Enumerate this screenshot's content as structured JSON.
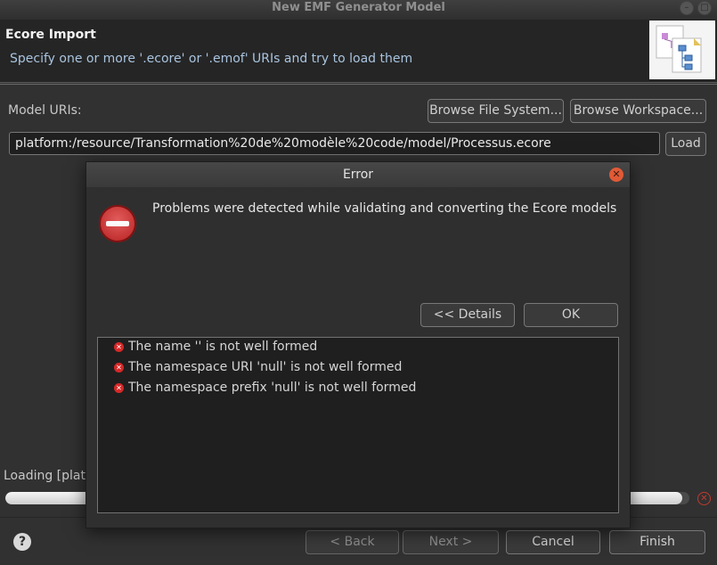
{
  "window": {
    "title": "New EMF Generator Model"
  },
  "header": {
    "title": "Ecore Import",
    "description": "Specify one or more '.ecore' or '.emof' URIs and try to load them",
    "image_icon": "ecore-import-wizard-icon"
  },
  "form": {
    "model_uris_label": "Model URIs:",
    "browse_file_system": "Browse File System...",
    "browse_workspace": "Browse Workspace...",
    "uri_value": "platform:/resource/Transformation%20de%20modèle%20code/model/Processus.ecore",
    "load": "Load"
  },
  "status": {
    "loading_text": "Loading [platf",
    "progress_fraction": 0.99
  },
  "footer": {
    "help_icon": "help-icon",
    "back": "< Back",
    "next": "Next >",
    "cancel": "Cancel",
    "finish": "Finish"
  },
  "dialog": {
    "title": "Error",
    "message": "Problems were detected while validating and converting the Ecore models",
    "details_button": "<< Details",
    "ok_button": "OK",
    "details": [
      "The name '' is not well formed",
      "The namespace URI 'null' is not well formed",
      "The namespace prefix 'null' is not well formed"
    ]
  },
  "colors": {
    "background": "#313131",
    "header_background": "#252525",
    "description_text": "#a9c4df",
    "error_red": "#d62828"
  }
}
